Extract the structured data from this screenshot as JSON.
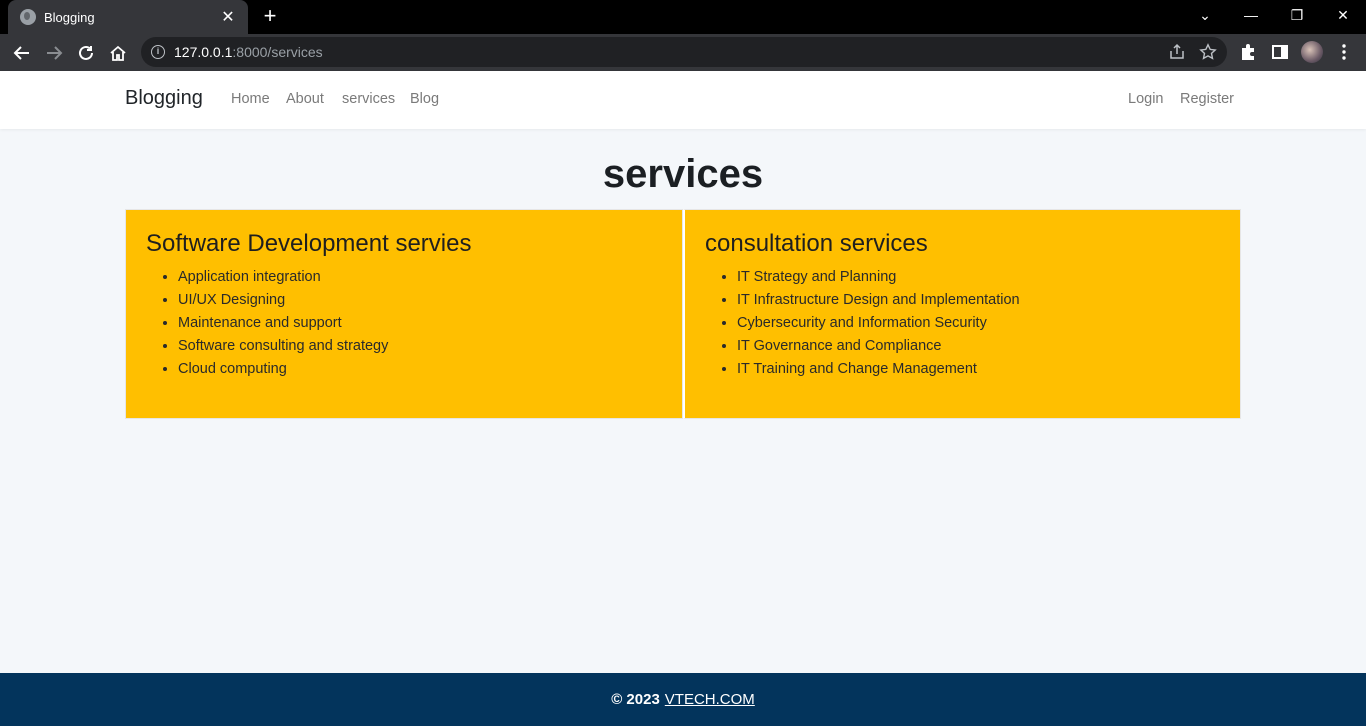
{
  "browser": {
    "tab_title": "Blogging",
    "tab_close": "✕",
    "new_tab": "+",
    "url_host": "127.0.0.1",
    "url_rest": ":8000/services",
    "info_glyph": "i",
    "window_controls": {
      "dropdown": "⌄",
      "minimize": "—",
      "restore": "❐",
      "close": "✕"
    }
  },
  "navbar": {
    "brand": "Blogging",
    "links": [
      "Home",
      "About",
      "services",
      "Blog"
    ],
    "auth": {
      "login": "Login",
      "register": "Register"
    }
  },
  "main": {
    "title": "services",
    "cards": [
      {
        "heading": "Software Development servies",
        "items": [
          "Application integration",
          "UI/UX Designing",
          "Maintenance and support",
          "Software consulting and strategy",
          "Cloud computing"
        ]
      },
      {
        "heading": "consultation services",
        "items": [
          "IT Strategy and Planning",
          "IT Infrastructure Design and Implementation",
          "Cybersecurity and Information Security",
          "IT Governance and Compliance",
          "IT Training and Change Management"
        ]
      }
    ]
  },
  "footer": {
    "copyright": "© 2023",
    "link": "VTECH.COM"
  },
  "colors": {
    "card_bg": "#ffbf00",
    "footer_bg": "#03345c",
    "page_bg": "#f4f7fa"
  }
}
